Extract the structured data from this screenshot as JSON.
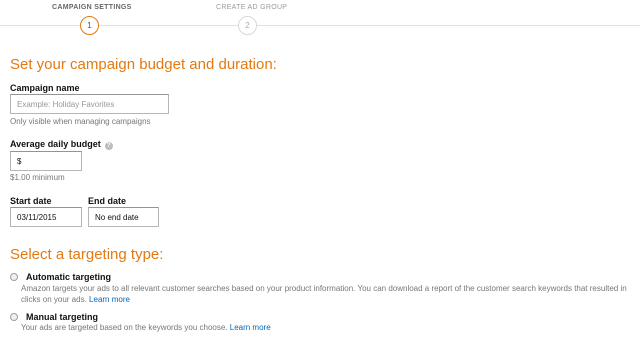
{
  "stepper": {
    "steps": [
      {
        "label": "CAMPAIGN SETTINGS",
        "number": "1"
      },
      {
        "label": "CREATE AD GROUP",
        "number": "2"
      }
    ]
  },
  "budget_section": {
    "heading": "Set your campaign budget and duration:",
    "campaign_name": {
      "label": "Campaign name",
      "placeholder": "Example: Holiday Favorites",
      "hint": "Only visible when managing campaigns"
    },
    "daily_budget": {
      "label": "Average daily budget",
      "value": "$",
      "hint": "$1.00 minimum"
    },
    "start_date": {
      "label": "Start date",
      "value": "03/11/2015"
    },
    "end_date": {
      "label": "End date",
      "value": "No end date"
    }
  },
  "targeting_section": {
    "heading": "Select a targeting type:",
    "automatic": {
      "title": "Automatic targeting",
      "description": "Amazon targets your ads to all relevant customer searches based on your product information. You can download a report of the customer search keywords that resulted in clicks on your ads.",
      "link": "Learn more"
    },
    "manual": {
      "title": "Manual targeting",
      "description": "Your ads are targeted based on the keywords you choose.",
      "link": "Learn more"
    }
  },
  "colors": {
    "accent": "#e47911",
    "link": "#0066c0"
  }
}
